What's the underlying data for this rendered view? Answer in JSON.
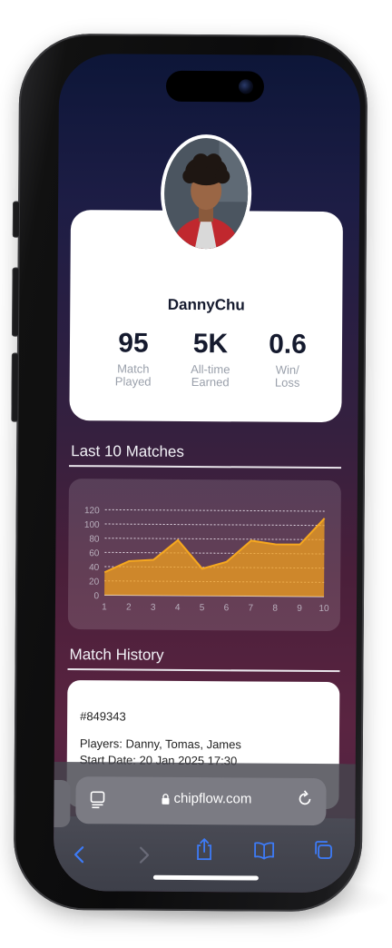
{
  "profile": {
    "username": "DannyChu",
    "stats": [
      {
        "value": "95",
        "label_line1": "Match",
        "label_line2": "Played"
      },
      {
        "value": "5K",
        "label_line1": "All-time",
        "label_line2": "Earned"
      },
      {
        "value": "0.6",
        "label_line1": "Win/",
        "label_line2": "Loss"
      }
    ]
  },
  "sections": {
    "last_matches_title": "Last 10 Matches",
    "history_title": "Match History"
  },
  "chart_data": {
    "type": "area",
    "x": [
      1,
      2,
      3,
      4,
      5,
      6,
      7,
      8,
      9,
      10
    ],
    "values": [
      32,
      48,
      50,
      78,
      38,
      48,
      78,
      73,
      73,
      110
    ],
    "ylim": [
      0,
      120
    ],
    "yticks": [
      0,
      20,
      40,
      60,
      80,
      100,
      120
    ],
    "grid": true,
    "color": "#f2a01e"
  },
  "history": [
    {
      "id": "#849343",
      "players": "Players: Danny, Tomas, James",
      "start_date": "Start Date: 20 Jan 2025 17:30"
    }
  ],
  "browser": {
    "url": "chipflow.com"
  },
  "colors": {
    "accent": "#3d7bf7",
    "chart_fill": "#f2a01e",
    "text_dark": "#151a2e"
  }
}
